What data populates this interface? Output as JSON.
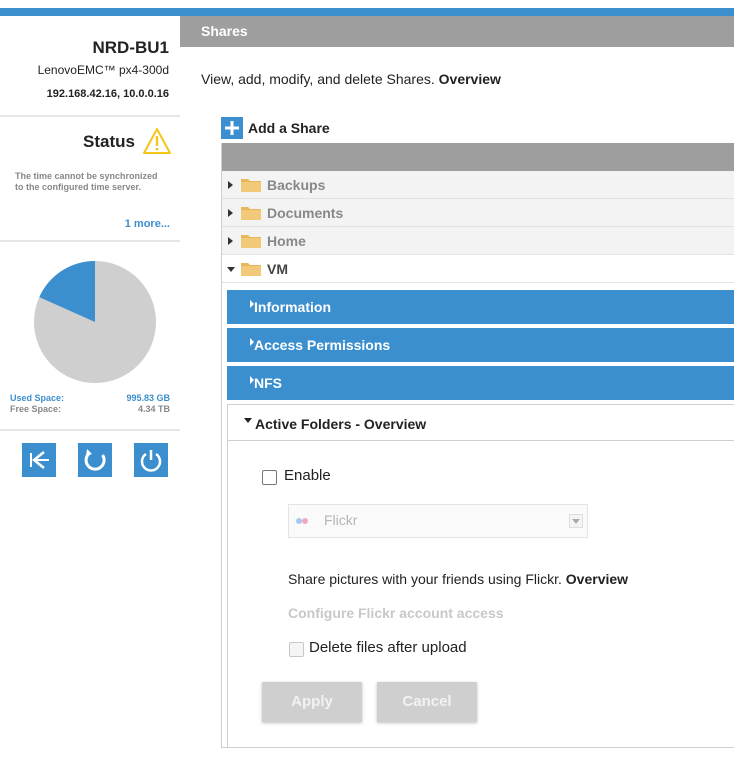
{
  "colors": {
    "accent": "#3b8fcf",
    "header_gray": "#9e9e9e",
    "warning": "#f5c518"
  },
  "device": {
    "name": "NRD-BU1",
    "model": "LenovoEMC™ px4-300d",
    "ip": "192.168.42.16, 10.0.0.16"
  },
  "status": {
    "title": "Status",
    "icon": "warning-icon",
    "message": "The time cannot be synchronized to the configured time server.",
    "more_link": "1 more..."
  },
  "storage": {
    "used_label": "Used Space:",
    "used_value": "995.83 GB",
    "free_label": "Free Space:",
    "free_value": "4.34 TB",
    "used_fraction": 0.183
  },
  "sidebar_buttons": [
    {
      "icon": "identify-icon"
    },
    {
      "icon": "refresh-icon"
    },
    {
      "icon": "power-icon"
    }
  ],
  "page": {
    "title": "Shares",
    "description": "View, add, modify, and delete Shares.",
    "overview_link": "Overview",
    "add_share_label": "Add a Share"
  },
  "shares": [
    {
      "name": "Backups",
      "expanded": false
    },
    {
      "name": "Documents",
      "expanded": false
    },
    {
      "name": "Home",
      "expanded": false
    },
    {
      "name": "VM",
      "expanded": true
    }
  ],
  "share_sections": {
    "information": "Information",
    "access_permissions": "Access Permissions",
    "nfs": "NFS",
    "active_folders": "Active Folders - Overview"
  },
  "active_folders": {
    "enable_label": "Enable",
    "enable_checked": false,
    "service_selected": "Flickr",
    "description": "Share pictures with your friends using Flickr.",
    "overview_link": "Overview",
    "configure_link": "Configure Flickr account access",
    "delete_label": "Delete files after upload",
    "apply_label": "Apply",
    "cancel_label": "Cancel"
  }
}
